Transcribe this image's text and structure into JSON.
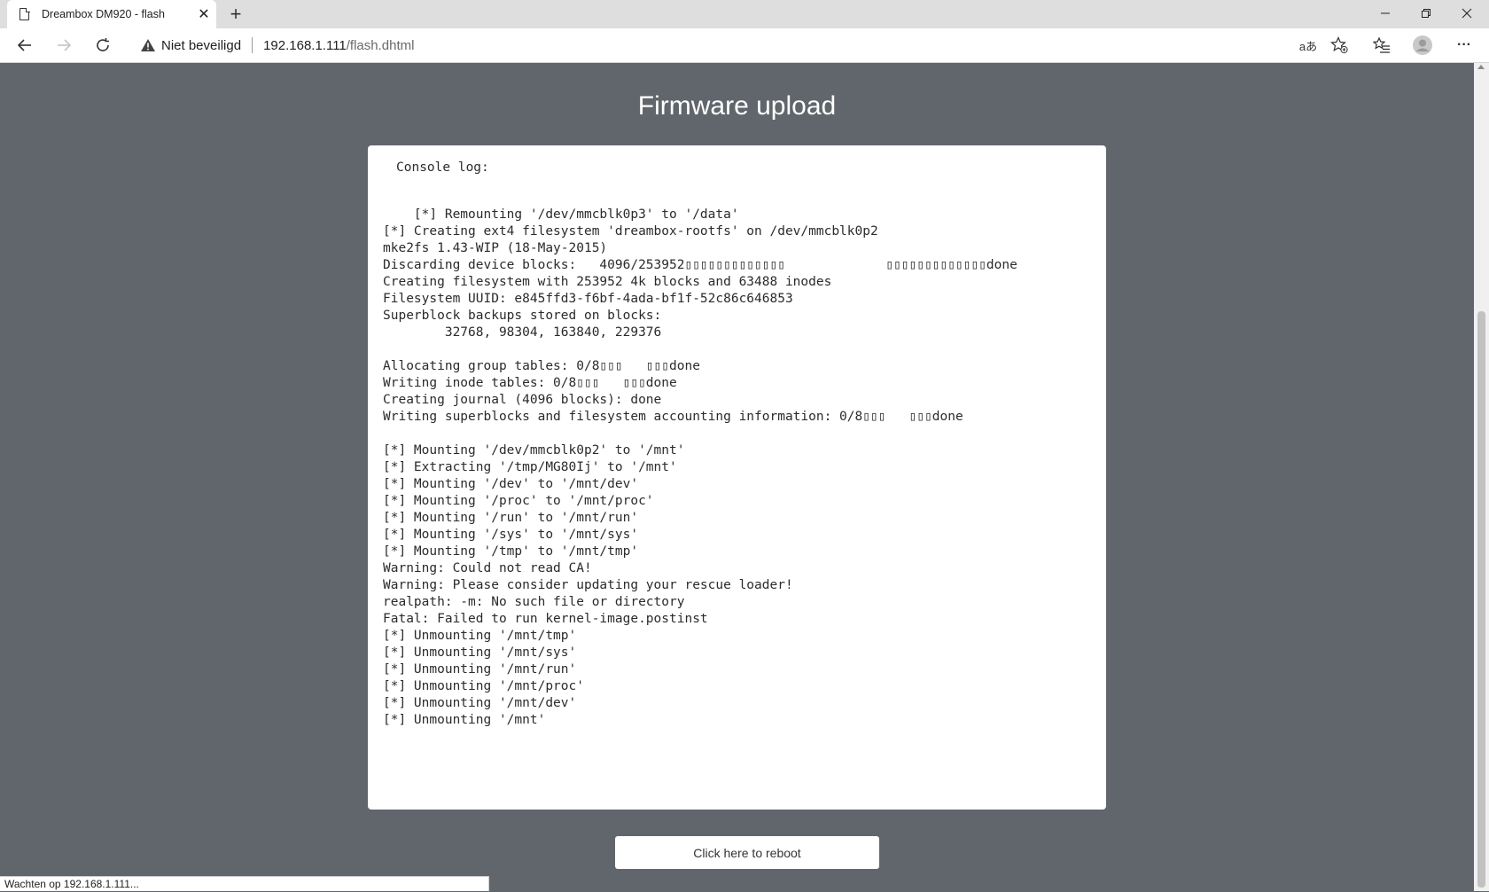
{
  "browser": {
    "tab": {
      "title": "Dreambox DM920 - flash"
    },
    "security_label": "Niet beveiligd",
    "url_host": "192.168.1.111",
    "url_path": "/flash.dhtml",
    "status_text": "Wachten op 192.168.1.111...",
    "icons": {
      "tab_page": "page-icon",
      "tab_close": "close-icon",
      "new_tab": "plus-icon",
      "minimize": "minimize-icon",
      "restore": "restore-icon",
      "close": "close-icon",
      "back": "arrow-left-icon",
      "forward": "arrow-right-icon",
      "reload": "reload-icon",
      "security": "warning-icon",
      "read_aloud": "read-aloud-icon",
      "add_favorite": "star-add-icon",
      "favorites": "favorites-icon",
      "profile": "avatar-icon",
      "more": "ellipsis-icon"
    },
    "read_aloud_glyph": "aあ",
    "more_glyph": "···"
  },
  "page": {
    "title": "Firmware upload",
    "console_label": "Console log:",
    "log_lines": [
      "    [*] Remounting '/dev/mmcblk0p3' to '/data'",
      "[*] Creating ext4 filesystem 'dreambox-rootfs' on /dev/mmcblk0p2",
      "mke2fs 1.43-WIP (18-May-2015)",
      "Discarding device blocks:   4096/253952▯▯▯▯▯▯▯▯▯▯▯▯▯             ▯▯▯▯▯▯▯▯▯▯▯▯▯done",
      "Creating filesystem with 253952 4k blocks and 63488 inodes",
      "Filesystem UUID: e845ffd3-f6bf-4ada-bf1f-52c86c646853",
      "Superblock backups stored on blocks:",
      "        32768, 98304, 163840, 229376",
      "",
      "Allocating group tables: 0/8▯▯▯   ▯▯▯done",
      "Writing inode tables: 0/8▯▯▯   ▯▯▯done",
      "Creating journal (4096 blocks): done",
      "Writing superblocks and filesystem accounting information: 0/8▯▯▯   ▯▯▯done",
      "",
      "[*] Mounting '/dev/mmcblk0p2' to '/mnt'",
      "[*] Extracting '/tmp/MG80Ij' to '/mnt'",
      "[*] Mounting '/dev' to '/mnt/dev'",
      "[*] Mounting '/proc' to '/mnt/proc'",
      "[*] Mounting '/run' to '/mnt/run'",
      "[*] Mounting '/sys' to '/mnt/sys'",
      "[*] Mounting '/tmp' to '/mnt/tmp'",
      "Warning: Could not read CA!",
      "Warning: Please consider updating your rescue loader!",
      "realpath: -m: No such file or directory",
      "Fatal: Failed to run kernel-image.postinst",
      "[*] Unmounting '/mnt/tmp'",
      "[*] Unmounting '/mnt/sys'",
      "[*] Unmounting '/mnt/run'",
      "[*] Unmounting '/mnt/proc'",
      "[*] Unmounting '/mnt/dev'",
      "[*] Unmounting '/mnt'"
    ],
    "reboot_label": "Click here to reboot"
  },
  "colors": {
    "page_background": "#61666c",
    "card_background": "#ffffff",
    "heading_text": "#ffffff"
  }
}
